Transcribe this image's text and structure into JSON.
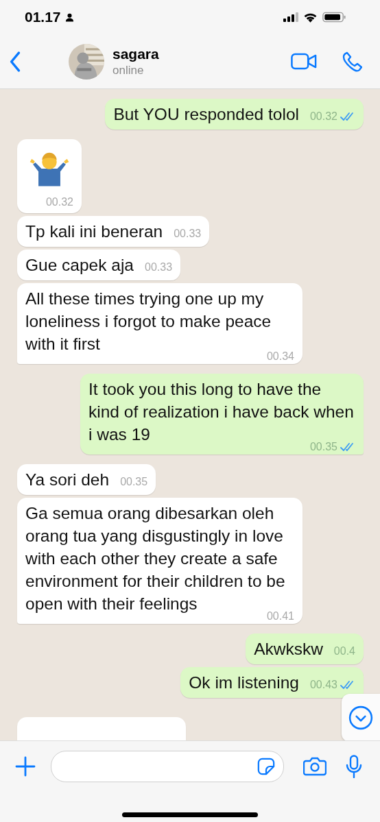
{
  "status_bar": {
    "time": "01.17"
  },
  "header": {
    "name": "sagara",
    "status": "online"
  },
  "messages": [
    {
      "kind": "text",
      "outgoing": true,
      "text": "But YOU responded tolol",
      "time": "00.32",
      "read": true,
      "tail": false
    },
    {
      "kind": "emoji",
      "outgoing": false,
      "time": "00.32",
      "tail": false
    },
    {
      "kind": "text",
      "outgoing": false,
      "text": "Tp kali ini beneran",
      "time": "00.33",
      "tail": false
    },
    {
      "kind": "text",
      "outgoing": false,
      "text": "Gue capek aja",
      "time": "00.33",
      "tail": false
    },
    {
      "kind": "text",
      "outgoing": false,
      "text": "All these times trying one up my loneliness i forgot to make peace with it first",
      "time": "00.34",
      "tail": true
    },
    {
      "kind": "text",
      "outgoing": true,
      "text": "It took you this long to have the kind of realization i have back when i was 19",
      "time": "00.35",
      "read": true,
      "tail": true
    },
    {
      "kind": "text",
      "outgoing": false,
      "text": "Ya sori deh",
      "time": "00.35",
      "tail": false
    },
    {
      "kind": "text",
      "outgoing": false,
      "text": "Ga semua orang dibesarkan oleh orang tua yang disgustingly in love with each other they create a safe environment for their children to be open with their feelings",
      "time": "00.41",
      "tail": true
    },
    {
      "kind": "text",
      "outgoing": true,
      "text": "Akwkskw",
      "time": "00.4",
      "read": false,
      "tail": false
    },
    {
      "kind": "text",
      "outgoing": true,
      "text": "Ok im listening",
      "time": "00.43",
      "read": true,
      "tail": true
    },
    {
      "kind": "partial",
      "outgoing": false
    }
  ]
}
